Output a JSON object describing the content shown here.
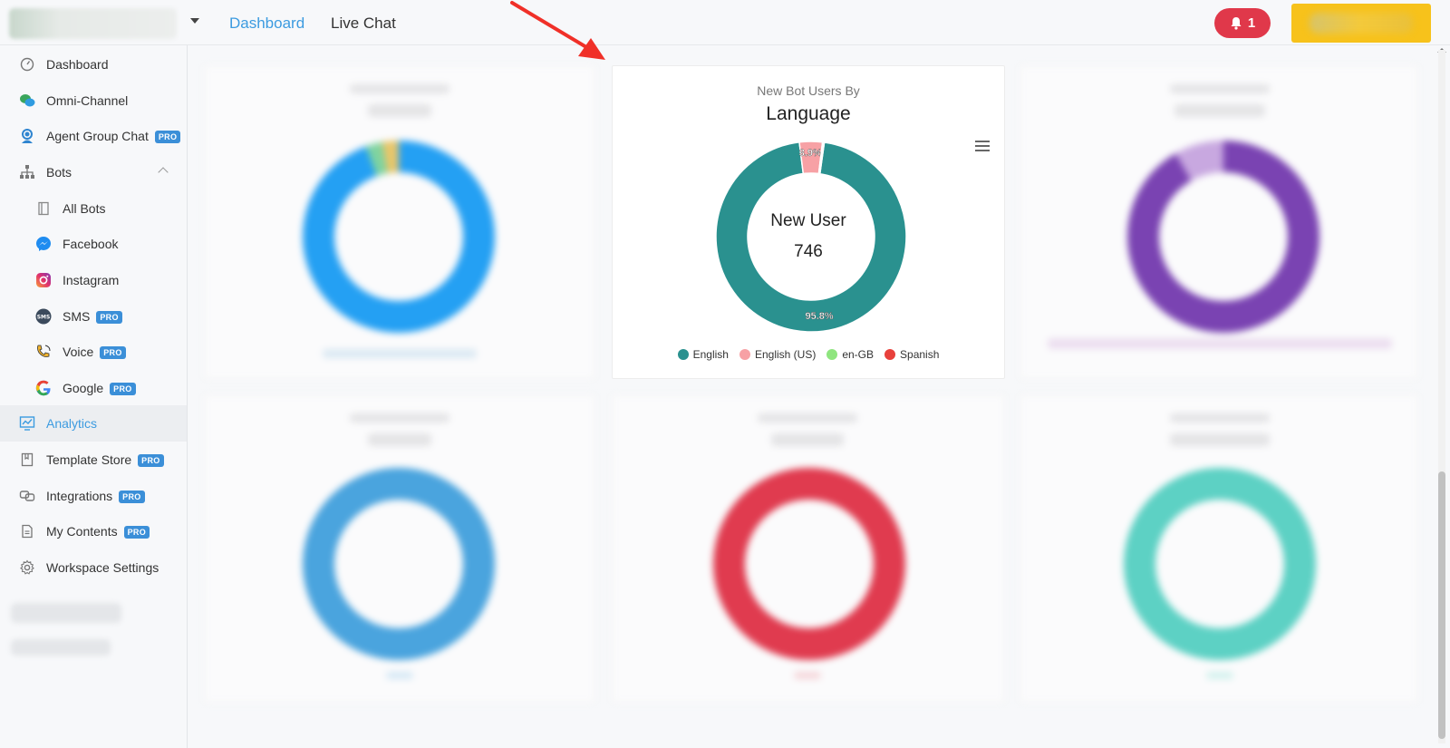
{
  "topbar": {
    "nav": [
      {
        "label": "Dashboard",
        "active": true
      },
      {
        "label": "Live Chat",
        "active": false
      }
    ],
    "notification_count": "1"
  },
  "sidebar": {
    "items": [
      {
        "label": "Dashboard",
        "icon": "gauge-icon",
        "pro": false
      },
      {
        "label": "Omni-Channel",
        "icon": "chat-bubbles-icon",
        "pro": false
      },
      {
        "label": "Agent Group Chat",
        "icon": "agent-headset-icon",
        "pro": true
      },
      {
        "label": "Bots",
        "icon": "sitemap-icon",
        "pro": false,
        "expanded": true
      },
      {
        "label": "All Bots",
        "icon": "book-icon",
        "pro": false,
        "sub": true
      },
      {
        "label": "Facebook",
        "icon": "messenger-icon",
        "pro": false,
        "sub": true
      },
      {
        "label": "Instagram",
        "icon": "instagram-icon",
        "pro": false,
        "sub": true
      },
      {
        "label": "SMS",
        "icon": "sms-icon",
        "pro": true,
        "sub": true
      },
      {
        "label": "Voice",
        "icon": "phone-icon",
        "pro": true,
        "sub": true
      },
      {
        "label": "Google",
        "icon": "google-icon",
        "pro": true,
        "sub": true
      },
      {
        "label": "Analytics",
        "icon": "analytics-icon",
        "pro": false,
        "active": true
      },
      {
        "label": "Template Store",
        "icon": "bookmark-icon",
        "pro": true
      },
      {
        "label": "Integrations",
        "icon": "link-icon",
        "pro": true
      },
      {
        "label": "My Contents",
        "icon": "document-icon",
        "pro": true
      },
      {
        "label": "Workspace Settings",
        "icon": "gear-icon",
        "pro": false
      }
    ],
    "pro_label": "PRO"
  },
  "featured_card": {
    "subtitle": "New Bot Users By",
    "title": "Language",
    "center_title": "New User",
    "center_value": "746"
  },
  "chart_data": {
    "type": "pie",
    "subtitle": "New Bot Users By",
    "title": "Language",
    "categories": [
      "English",
      "English (US)",
      "en-GB",
      "Spanish"
    ],
    "values": [
      95.8,
      3.9,
      0.15,
      0.15
    ],
    "data_labels": [
      "95.8%",
      "3.9%",
      "",
      ""
    ],
    "colors": [
      "#2a918f",
      "#f7a1a5",
      "#8fe57f",
      "#e8413c"
    ],
    "total_label": "New User",
    "total": 746,
    "legend_position": "bottom"
  },
  "colors": {
    "accent": "#3c9be0",
    "notification": "#e0384a",
    "upgrade": "#f7c21b",
    "pro_badge": "#3b8fd8"
  }
}
